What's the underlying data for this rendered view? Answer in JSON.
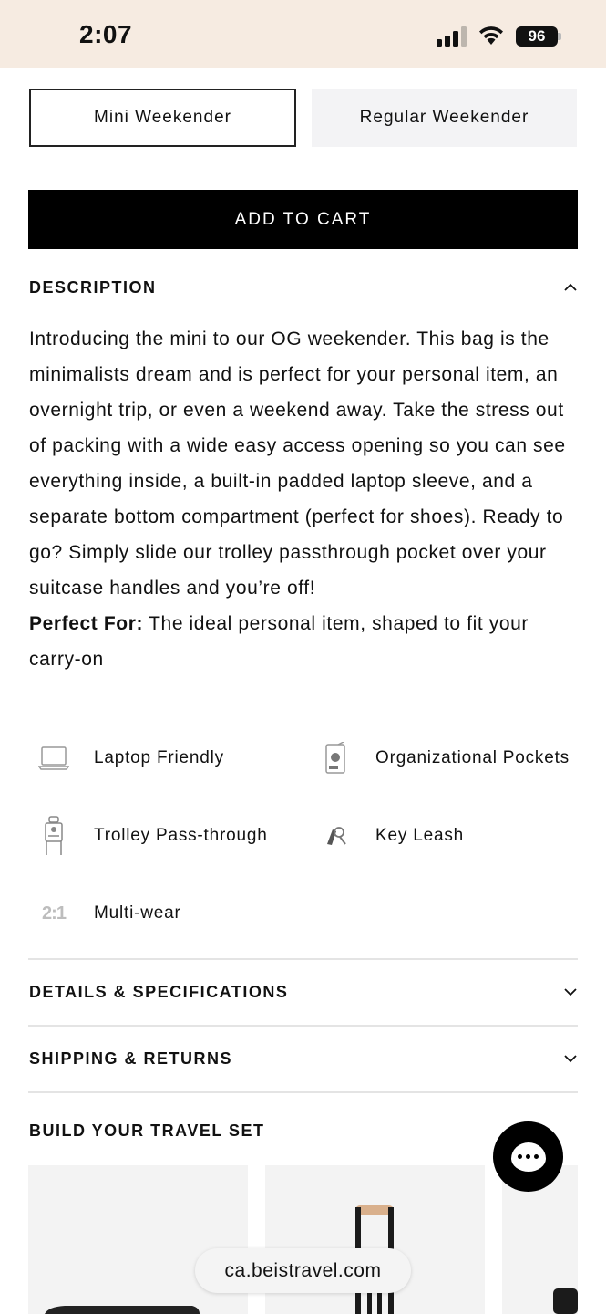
{
  "status_bar": {
    "time": "2:07",
    "battery": "96",
    "background_color": "#f6ebe1"
  },
  "variants": [
    {
      "label": "Mini Weekender",
      "selected": true
    },
    {
      "label": "Regular Weekender",
      "selected": false
    }
  ],
  "add_to_cart": {
    "label": "ADD TO CART"
  },
  "description": {
    "title": "DESCRIPTION",
    "expanded": true,
    "body": "Introducing the mini to our OG weekender. This bag is the minimalists dream and is perfect for your personal item, an overnight trip, or even a weekend away. Take the stress out of packing with a wide easy access opening so you can see everything inside, a built-in padded laptop sleeve, and a separate bottom compartment (perfect for shoes). Ready to go? Simply slide our trolley passthrough pocket over your suitcase handles and you’re off!",
    "perfect_for_label": "Perfect For:",
    "perfect_for_text": " The ideal personal item, shaped to fit your carry-on"
  },
  "features": [
    {
      "label": "Laptop Friendly",
      "icon": "laptop-icon"
    },
    {
      "label": "Organizational Pockets",
      "icon": "pockets-icon"
    },
    {
      "label": "Trolley Pass-through",
      "icon": "trolley-icon"
    },
    {
      "label": "Key Leash",
      "icon": "key-icon"
    },
    {
      "label": "Multi-wear",
      "icon": "multiwear-icon",
      "icon_text": "2:1"
    }
  ],
  "details": {
    "title": "DETAILS & SPECIFICATIONS",
    "expanded": false
  },
  "shipping": {
    "title": "SHIPPING & RETURNS",
    "expanded": false
  },
  "travel_set": {
    "title": "BUILD YOUR TRAVEL SET"
  },
  "browser": {
    "url": "ca.beistravel.com"
  }
}
